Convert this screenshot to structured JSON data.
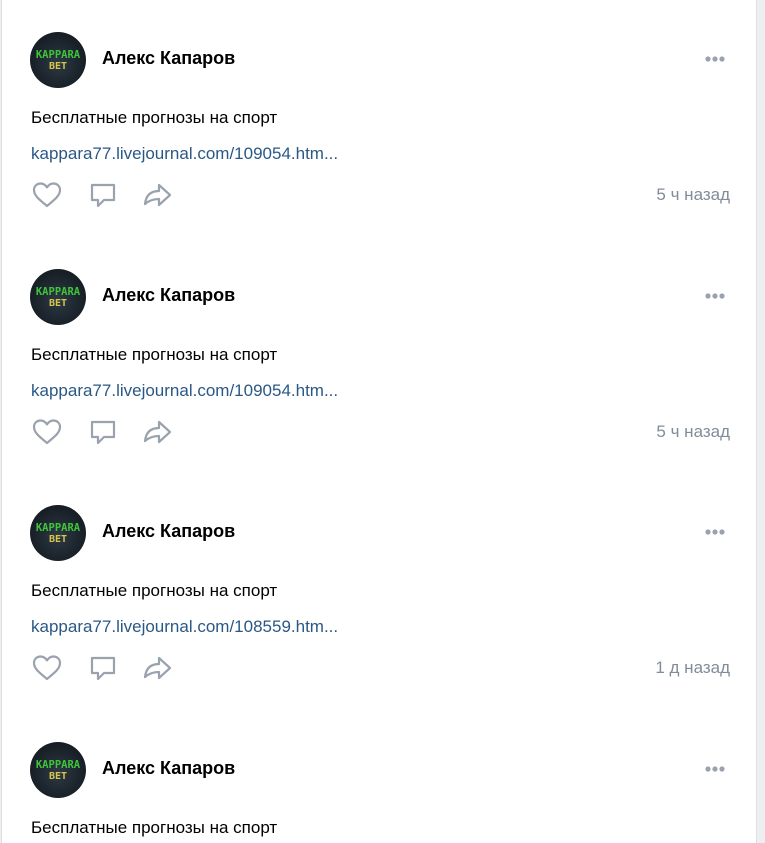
{
  "posts": [
    {
      "author": "Алекс Капаров",
      "text": "Бесплатные прогнозы на спорт",
      "link": "kappara77.livejournal.com/109054.htm...",
      "time": "5 ч назад",
      "avatar_text": [
        "KAPPARA",
        "BET"
      ]
    },
    {
      "author": "Алекс Капаров",
      "text": "Бесплатные прогнозы на спорт",
      "link": "kappara77.livejournal.com/109054.htm...",
      "time": "5 ч назад",
      "avatar_text": [
        "KAPPARA",
        "BET"
      ]
    },
    {
      "author": "Алекс Капаров",
      "text": "Бесплатные прогнозы на спорт",
      "link": "kappara77.livejournal.com/108559.htm...",
      "time": "1 д назад",
      "avatar_text": [
        "KAPPARA",
        "BET"
      ]
    },
    {
      "author": "Алекс Капаров",
      "text": "Бесплатные прогнозы на спорт",
      "link": "",
      "time": "",
      "avatar_text": [
        "KAPPARA",
        "BET"
      ]
    }
  ],
  "icons": {
    "more": "more-horizontal-icon",
    "like": "heart-outline-icon",
    "comment": "comment-outline-icon",
    "share": "share-arrow-icon"
  },
  "colors": {
    "link": "#2a5885",
    "secondary": "#818c99",
    "icon": "#99a2ad",
    "avatar_text_top": "#3fc43a",
    "avatar_text_bottom": "#d8c64a"
  }
}
